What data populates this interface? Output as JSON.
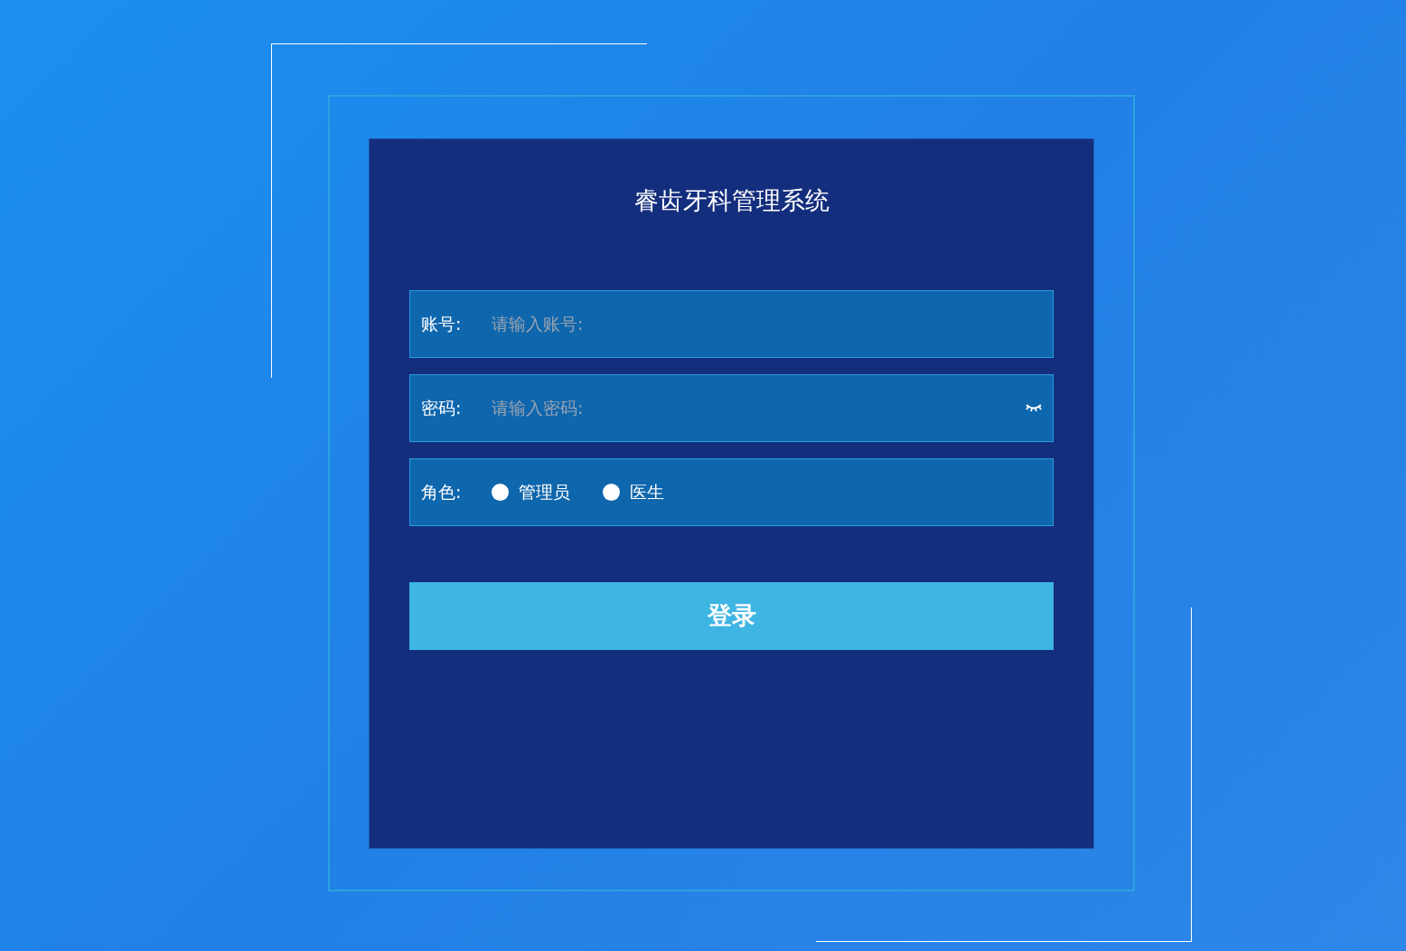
{
  "title": "睿齿牙科管理系统",
  "account": {
    "label": "账号:",
    "placeholder": "请输入账号:"
  },
  "password": {
    "label": "密码:",
    "placeholder": "请输入密码:",
    "visible": false
  },
  "role": {
    "label": "角色:",
    "options": [
      {
        "label": "管理员",
        "selected": false
      },
      {
        "label": "医生",
        "selected": false
      }
    ]
  },
  "login_button": "登录"
}
